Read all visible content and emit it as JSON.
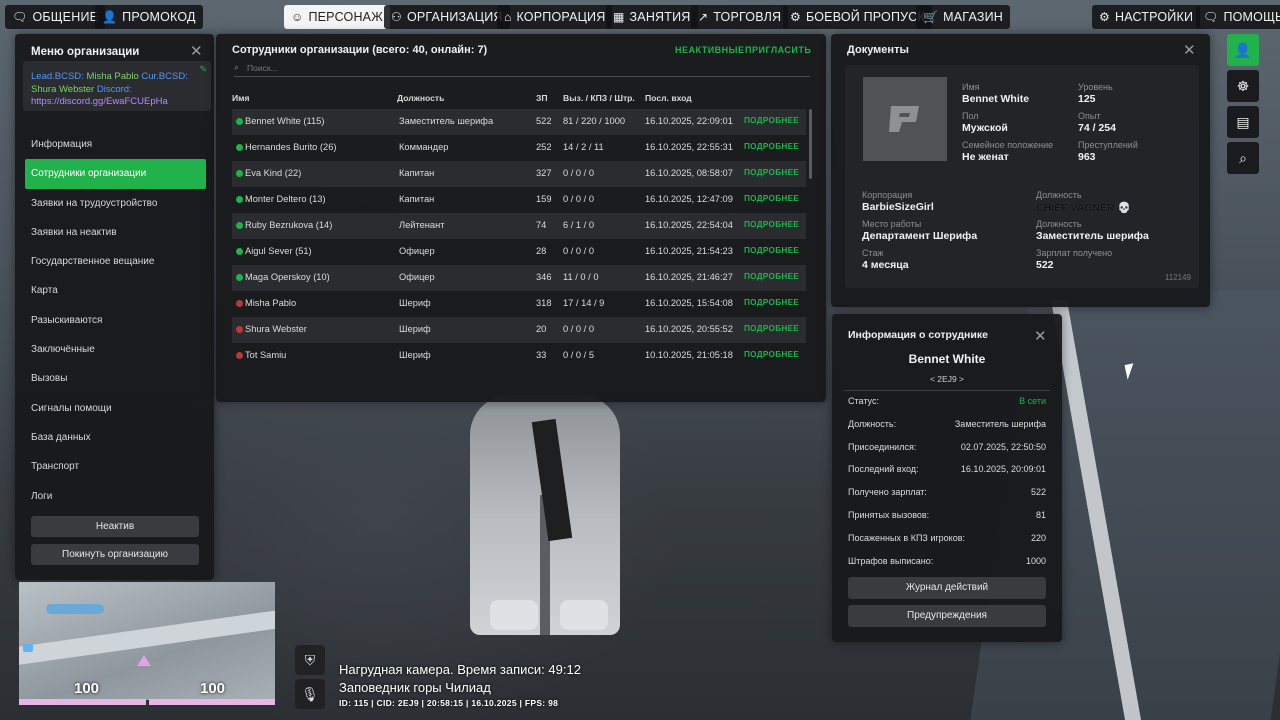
{
  "nav": {
    "left": [
      {
        "label": "ОБЩЕНИЕ",
        "icon": "chat-icon",
        "glyph": "🗨"
      },
      {
        "label": "ПРОМОКОД",
        "icon": "person-icon",
        "glyph": "👤"
      },
      {
        "label": "ПЕРСОНАЖ",
        "icon": "profile-icon",
        "glyph": "☺",
        "active": true
      },
      {
        "label": "ОРГАНИЗАЦИЯ",
        "icon": "group-icon",
        "glyph": "⚇"
      },
      {
        "label": "КОРПОРАЦИЯ",
        "icon": "building-icon",
        "glyph": "⌂"
      },
      {
        "label": "ЗАНЯТИЯ",
        "icon": "calendar-icon",
        "glyph": "▦"
      },
      {
        "label": "ТОРГОВЛЯ",
        "icon": "chart-icon",
        "glyph": "↗"
      },
      {
        "label": "БОЕВОЙ ПРОПУСК",
        "icon": "gear-badge-icon",
        "glyph": "⚙"
      },
      {
        "label": "МАГАЗИН",
        "icon": "cart-icon",
        "glyph": "🛒"
      }
    ],
    "right": [
      {
        "label": "НАСТРОЙКИ",
        "icon": "settings-icon",
        "glyph": "⚙"
      },
      {
        "label": "ПОМОЩЬ",
        "icon": "help-icon",
        "glyph": "🗨"
      }
    ]
  },
  "menu": {
    "title": "Меню организации",
    "motd": {
      "lead_label": "Lead.BCSD:",
      "lead_name": "Misha Pablo",
      "cur_label": "Cur.BCSD:",
      "cur_name": "Shura Webster",
      "discord_label": "Discord:",
      "discord_link": "https://discord.gg/EwaFCUEpHa"
    },
    "items": [
      "Информация",
      "Сотрудники организации",
      "Заявки на трудоустройство",
      "Заявки на неактив",
      "Государственное вещание",
      "Карта",
      "Разыскиваются",
      "Заключённые",
      "Вызовы",
      "Сигналы помощи",
      "База данных",
      "Транспорт",
      "Логи"
    ],
    "active_index": 1,
    "btn_inactive": "Неактив",
    "btn_leave": "Покинуть организацию"
  },
  "employees": {
    "title": "Сотрудники организации (всего: 40, онлайн: 7)",
    "link_inactive": "НЕАКТИВНЫЕ",
    "link_invite": "ПРИГЛАСИТЬ",
    "search_placeholder": "Поиск...",
    "headers": {
      "name": "Имя",
      "position": "Должность",
      "salary": "ЗП",
      "stats": "Выз. / КПЗ / Штр.",
      "last": "Посл. вход"
    },
    "more_label": "ПОДРОБНЕЕ",
    "online_color": "#22b24c",
    "offline_color": "#b53a3a",
    "rows": [
      {
        "name": "Bennet White (115)",
        "position": "Заместитель шерифа",
        "salary": "522",
        "stats": "81 / 220 / 1000",
        "last": "16.10.2025, 22:09:01",
        "online": true
      },
      {
        "name": "Hernandes Burito (26)",
        "position": "Коммандер",
        "salary": "252",
        "stats": "14 / 2 / 11",
        "last": "16.10.2025, 22:55:31",
        "online": true
      },
      {
        "name": "Eva Kind (22)",
        "position": "Капитан",
        "salary": "327",
        "stats": "0 / 0 / 0",
        "last": "16.10.2025, 08:58:07",
        "online": true
      },
      {
        "name": "Monter Deltero (13)",
        "position": "Капитан",
        "salary": "159",
        "stats": "0 / 0 / 0",
        "last": "16.10.2025, 12:47:09",
        "online": true
      },
      {
        "name": "Ruby Bezrukova (14)",
        "position": "Лейтенант",
        "salary": "74",
        "stats": "6 / 1 / 0",
        "last": "16.10.2025, 22:54:04",
        "online": true
      },
      {
        "name": "Aigul Sever (51)",
        "position": "Офицер",
        "salary": "28",
        "stats": "0 / 0 / 0",
        "last": "16.10.2025, 21:54:23",
        "online": true
      },
      {
        "name": "Maga Operskoy (10)",
        "position": "Офицер",
        "salary": "346",
        "stats": "11 / 0 / 0",
        "last": "16.10.2025, 21:46:27",
        "online": true
      },
      {
        "name": "Misha Pablo",
        "position": "Шериф",
        "salary": "318",
        "stats": "17 / 14 / 9",
        "last": "16.10.2025, 15:54:08",
        "online": false
      },
      {
        "name": "Shura Webster",
        "position": "Шериф",
        "salary": "20",
        "stats": "0 / 0 / 0",
        "last": "16.10.2025, 20:55:52",
        "online": false
      },
      {
        "name": "Tot Samiu",
        "position": "Шериф",
        "salary": "33",
        "stats": "0 / 0 / 5",
        "last": "10.10.2025, 21:05:18",
        "online": false
      }
    ]
  },
  "documents": {
    "title": "Документы",
    "name_label": "Имя",
    "name": "Bennet White",
    "level_label": "Уровень",
    "level": "125",
    "gender_label": "Пол",
    "gender": "Мужской",
    "exp_label": "Опыт",
    "exp": "74 / 254",
    "family_label": "Семейное положение",
    "family": "Не женат",
    "crimes_label": "Преступлений",
    "crimes": "963",
    "corp_label": "Корпорация",
    "corp": "BarbieSizeGirl",
    "corp_pos_label": "Должность",
    "corp_pos": "CHIEF VAGNER",
    "work_label": "Место работы",
    "work": "Департамент Шерифа",
    "work_pos_label": "Должность",
    "work_pos": "Заместитель шерифа",
    "tenure_label": "Стаж",
    "tenure": "4 месяца",
    "salary_label": "Зарплат получено",
    "salary": "522",
    "doc_number": "112149"
  },
  "info": {
    "title": "Информация о сотруднике",
    "name": "Bennet White",
    "cid": "< 2EJ9 >",
    "rows": [
      {
        "k": "Статус:",
        "v": "В сети",
        "green": true
      },
      {
        "k": "Должность:",
        "v": "Заместитель шерифа"
      },
      {
        "k": "Присоединился:",
        "v": "02.07.2025, 22:50:50"
      },
      {
        "k": "Последний вход:",
        "v": "16.10.2025, 20:09:01"
      },
      {
        "k": "Получено зарплат:",
        "v": "522"
      },
      {
        "k": "Принятых вызовов:",
        "v": "81"
      },
      {
        "k": "Посаженных в КПЗ игроков:",
        "v": "220"
      },
      {
        "k": "Штрафов выписано:",
        "v": "1000"
      }
    ],
    "btn_log": "Журнал действий",
    "btn_warn": "Предупреждения"
  },
  "side_icons": [
    {
      "icon": "user-icon",
      "glyph": "👤",
      "active": true
    },
    {
      "icon": "steering-wheel-icon",
      "glyph": "☸"
    },
    {
      "icon": "document-icon",
      "glyph": "▤"
    },
    {
      "icon": "magnifier-icon",
      "glyph": "⌕"
    }
  ],
  "hud": {
    "health": "100",
    "armor": "100",
    "bodycam": "Нагрудная камера. Время записи: 49:12",
    "location": "Заповедник горы Чилиад",
    "status": "ID: 115 | CID: 2EJ9 | 20:58:15 | 16.10.2025 | FPS: 98"
  }
}
